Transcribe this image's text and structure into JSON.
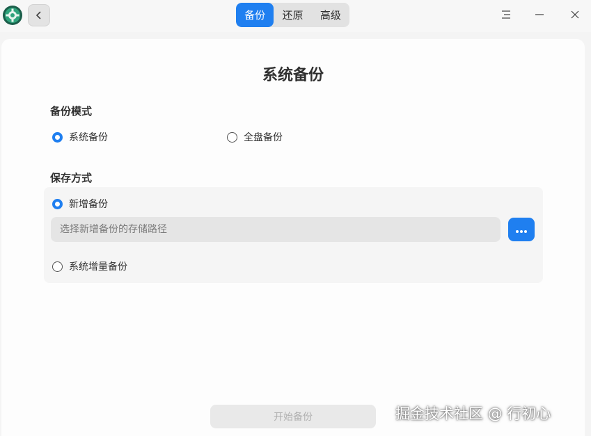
{
  "header": {
    "tabs": [
      {
        "label": "备份",
        "active": true
      },
      {
        "label": "还原",
        "active": false
      },
      {
        "label": "高级",
        "active": false
      }
    ]
  },
  "main": {
    "title": "系统备份",
    "backup_mode": {
      "title": "备份模式",
      "options": [
        {
          "label": "系统备份",
          "checked": true
        },
        {
          "label": "全盘备份",
          "checked": false
        }
      ]
    },
    "save_method": {
      "title": "保存方式",
      "options": [
        {
          "label": "新增备份",
          "checked": true
        },
        {
          "label": "系统增量备份",
          "checked": false
        }
      ],
      "path_placeholder": "选择新增备份的存储路径",
      "path_value": ""
    },
    "start_button": "开始备份"
  },
  "watermark": "掘金技术社区 @ 行初心",
  "colors": {
    "accent": "#1f7ff0",
    "app_icon": "#1f8f6a"
  },
  "icons": {
    "app": "gear-shield-icon",
    "back": "chevron-left-icon",
    "menu": "menu-icon",
    "minimize": "minimize-icon",
    "close": "close-icon",
    "browse": "more-dots-icon"
  }
}
